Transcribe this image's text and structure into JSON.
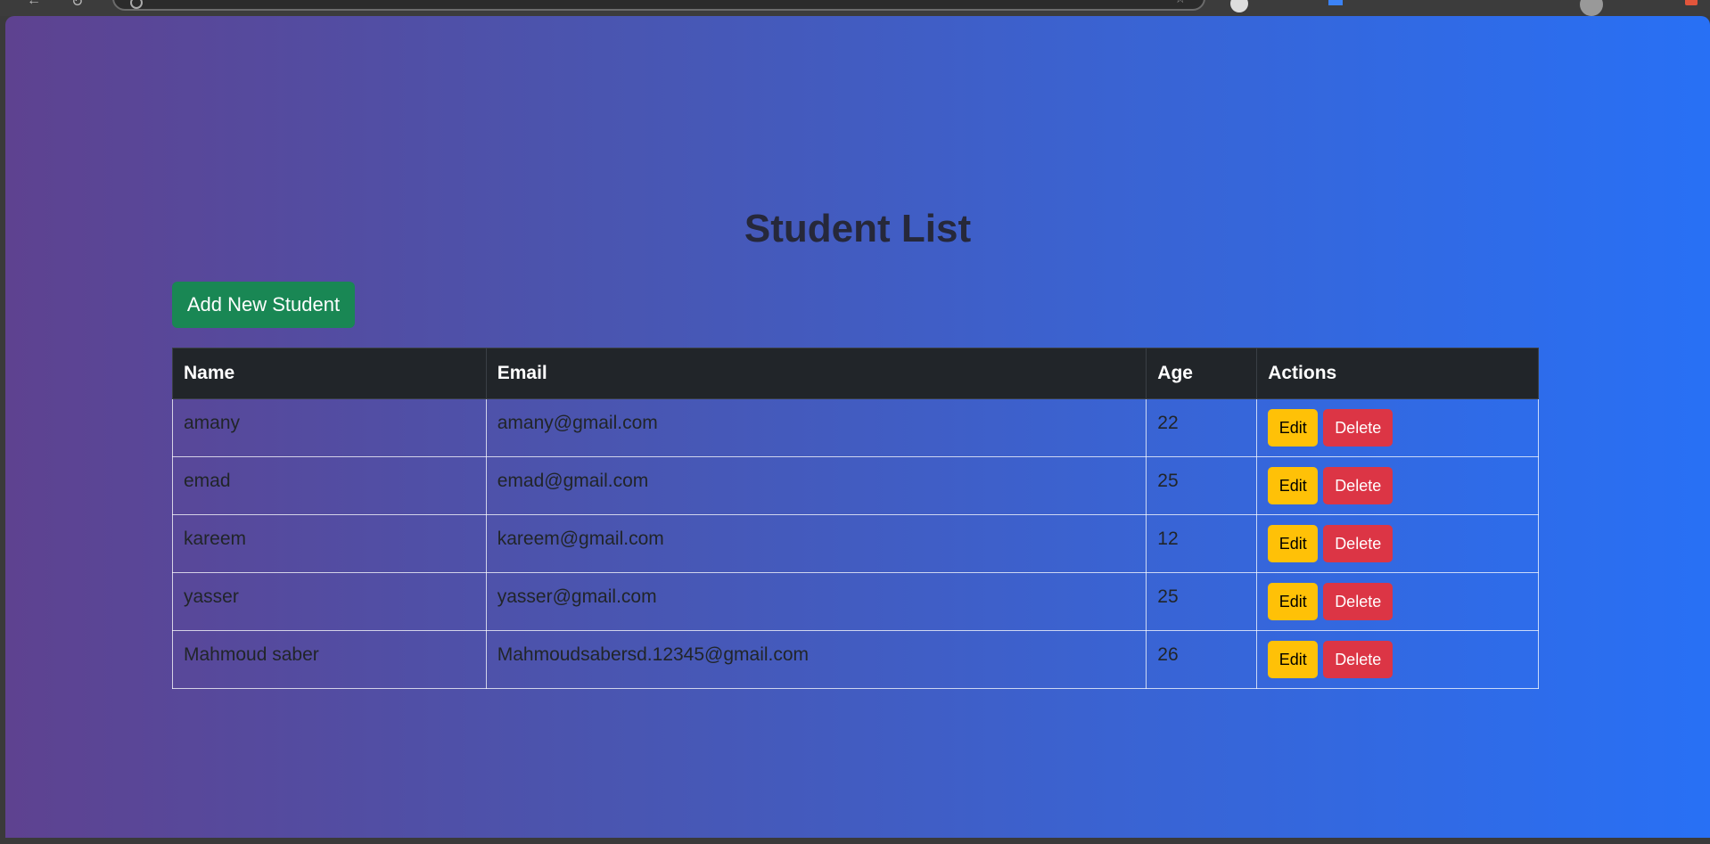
{
  "page": {
    "title": "Student List",
    "add_button_label": "Add New Student"
  },
  "table": {
    "headers": [
      "Name",
      "Email",
      "Age",
      "Actions"
    ],
    "rows": [
      {
        "name": "amany",
        "email": "amany@gmail.com",
        "age": "22"
      },
      {
        "name": "emad",
        "email": "emad@gmail.com",
        "age": "25"
      },
      {
        "name": "kareem",
        "email": "kareem@gmail.com",
        "age": "12"
      },
      {
        "name": "yasser",
        "email": "yasser@gmail.com",
        "age": "25"
      },
      {
        "name": "Mahmoud saber",
        "email": "Mahmoudsabersd.12345@gmail.com",
        "age": "26"
      }
    ],
    "edit_label": "Edit",
    "delete_label": "Delete"
  },
  "colors": {
    "gradient_start": "#5e4290",
    "gradient_end": "#2870f5",
    "add_button": "#198754",
    "edit_button": "#ffc107",
    "delete_button": "#dc3545",
    "table_header": "#212529"
  }
}
